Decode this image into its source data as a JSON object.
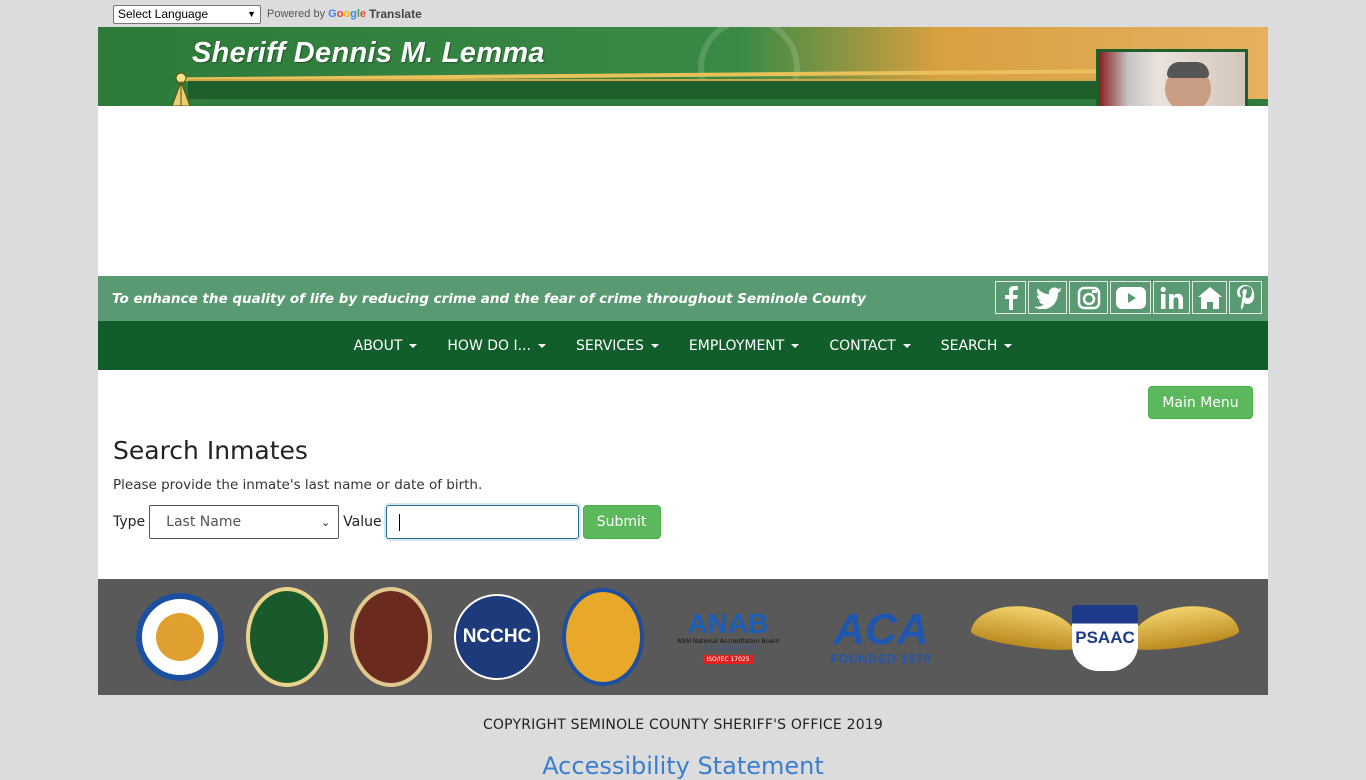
{
  "translate": {
    "language_select": "Select Language",
    "powered_by": "Powered by",
    "google": [
      "G",
      "o",
      "o",
      "g",
      "l",
      "e"
    ],
    "translate_word": "Translate"
  },
  "header": {
    "title": "Sheriff Dennis M. Lemma"
  },
  "mission": {
    "motto": "To enhance the quality of life by reducing crime and the fear of crime throughout Seminole County",
    "social": [
      "facebook-icon",
      "twitter-icon",
      "instagram-icon",
      "youtube-icon",
      "linkedin-icon",
      "nextdoor-icon",
      "pinterest-icon"
    ]
  },
  "nav": {
    "items": [
      "ABOUT",
      "HOW DO I...",
      "SERVICES",
      "EMPLOYMENT",
      "CONTACT",
      "SEARCH"
    ]
  },
  "content": {
    "main_menu": "Main Menu",
    "title": "Search Inmates",
    "instructions": "Please provide the inmate's last name or date of birth.",
    "type_label": "Type",
    "type_value": "Last Name",
    "value_label": "Value",
    "value_text": "",
    "submit": "Submit"
  },
  "logos": {
    "ncchc": "NCCHC",
    "anab": "ANAB",
    "anab_sub": "ANSI National Accreditation Board",
    "anab_acc": "ACCREDITED",
    "anab_iso": "ISO/IEC 17025",
    "aca": "ACA",
    "aca_founded": "FOUNDED 1870",
    "psaac": "PSAAC"
  },
  "footer": {
    "copyright": "COPYRIGHT SEMINOLE COUNTY SHERIFF'S OFFICE 2019",
    "accessibility": "Accessibility Statement"
  },
  "colors": {
    "nav_bg": "#115e2c",
    "mission_bg": "#5a9a72",
    "button_green": "#5cb85c",
    "logo_strip": "#595959"
  }
}
